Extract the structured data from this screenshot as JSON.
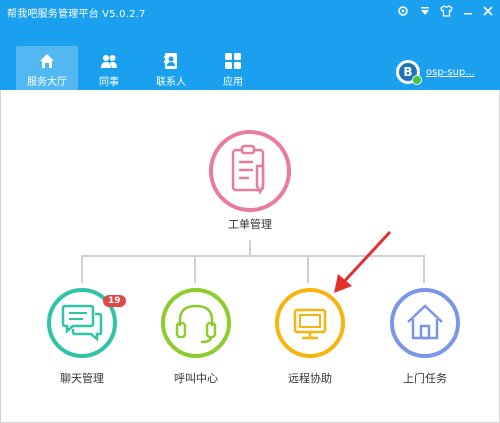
{
  "window": {
    "title": "帮我吧服务管理平台 V5.0.2.7",
    "controls": [
      "settings-icon",
      "dropdown-icon",
      "skin-icon",
      "minimize-icon",
      "close-icon"
    ]
  },
  "nav": [
    {
      "label": "服务大厅",
      "icon": "home-icon",
      "active": true
    },
    {
      "label": "同事",
      "icon": "colleagues-icon",
      "active": false
    },
    {
      "label": "联系人",
      "icon": "contacts-icon",
      "active": false
    },
    {
      "label": "应用",
      "icon": "apps-icon",
      "active": false
    }
  ],
  "user": {
    "name": "osp-sup..."
  },
  "center": {
    "label": "工单管理",
    "color": "#ea7aa1"
  },
  "services": [
    {
      "label": "聊天管理",
      "color": "#2fc4a8",
      "badge": "19"
    },
    {
      "label": "呼叫中心",
      "color": "#8ccc2c"
    },
    {
      "label": "远程协助",
      "color": "#f5b40e"
    },
    {
      "label": "上门任务",
      "color": "#7b95e8"
    }
  ],
  "colors": {
    "header": "#1aa0ee",
    "arrow": "#e23030"
  }
}
